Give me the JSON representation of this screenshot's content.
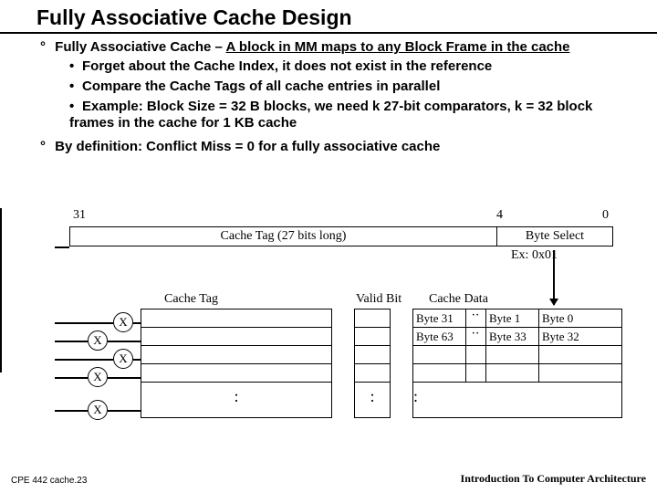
{
  "title": "Fully Associative Cache Design",
  "bullet1_prefix": "Fully Associative Cache – ",
  "bullet1_ul": "A block in MM maps to any Block Frame in the cache",
  "sub1": "Forget about the Cache Index, it does not exist in the reference",
  "sub2": "Compare the Cache Tags of  all cache entries in parallel",
  "sub3": "Example: Block Size = 32 B blocks, we need k 27-bit comparators, k = 32 block frames in the cache for 1 KB cache",
  "bullet2": "By definition: Conflict Miss = 0 for a fully associative cache",
  "bits": {
    "hi": "31",
    "mid": "4",
    "lo": "0"
  },
  "addr": {
    "tag": "Cache Tag (27 bits long)",
    "bs": "Byte Select"
  },
  "ex": "Ex: 0x01",
  "hdr": {
    "ct": "Cache Tag",
    "vb": "Valid Bit",
    "cd": "Cache Data"
  },
  "cmp": "X",
  "data": {
    "r0c1": "Byte 31",
    "r0c2": "Byte 1",
    "r0c3": "Byte 0",
    "r1c1": "Byte 63",
    "r1c2": "Byte 33",
    "r1c3": "Byte 32",
    "dots": "··"
  },
  "colon": ":",
  "footer_l": "CPE 442  cache.23",
  "footer_r": "Introduction To Computer Architecture"
}
